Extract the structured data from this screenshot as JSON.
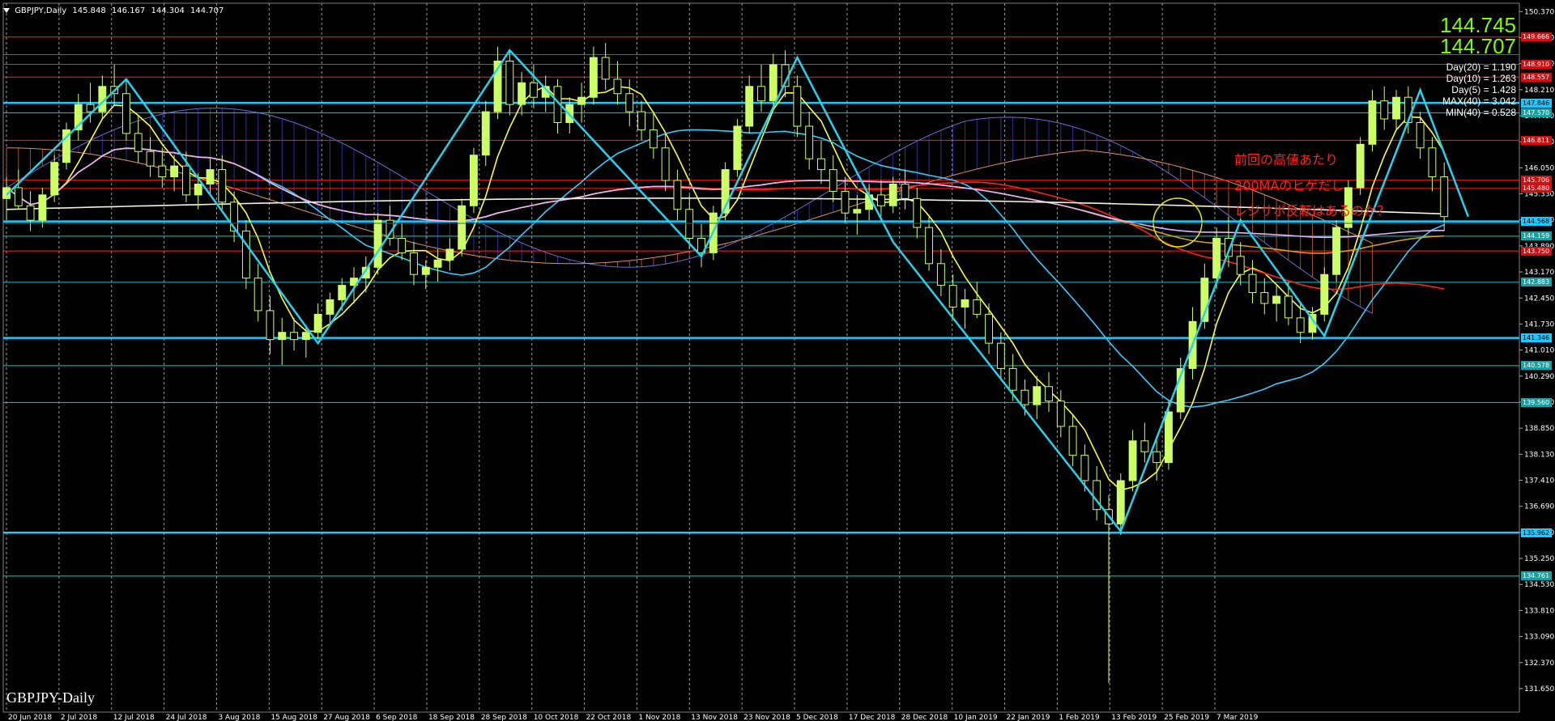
{
  "header": {
    "symbol": "GBPJPY,Daily",
    "open": "145.848",
    "high": "146.167",
    "low": "144.304",
    "close": "144.707"
  },
  "prices": {
    "bid": "144.745",
    "ask": "144.707"
  },
  "stats": [
    "Day(20) = 1.190",
    "Day(10) = 1.263",
    "Day(5) = 1.428",
    "MAX(40) = 3.042",
    "MIN(40) = 0.528"
  ],
  "annotations": [
    "前回の高値あたり",
    "200MAのヒゲだし",
    "レジサポ反転はあるのか？"
  ],
  "chart_label": "GBPJPY-Daily",
  "colors": {
    "background": "#000000",
    "bull_candle": "#ccff66",
    "hline": "#19c8c8",
    "hline_strong": "#1ec8ff",
    "red_line": "#ff2020",
    "annotation": "#ff2020",
    "price_text": "#7cfc00",
    "zigzag": "#21d4f0"
  },
  "chart_data": {
    "type": "candlestick",
    "title": "GBPJPY-Daily",
    "ylim": [
      131.0,
      150.6
    ],
    "y_ticks": [
      "150.370",
      "149.650",
      "148.930",
      "148.210",
      "147.490",
      "146.770",
      "146.050",
      "145.330",
      "144.610",
      "143.890",
      "143.170",
      "142.450",
      "141.730",
      "141.010",
      "140.290",
      "139.570",
      "138.850",
      "138.130",
      "137.410",
      "136.690",
      "135.970",
      "135.250",
      "134.530",
      "133.810",
      "133.090",
      "132.370",
      "131.650"
    ],
    "x_labels": [
      "20 Jun 2018",
      "2 Jul 2018",
      "12 Jul 2018",
      "24 Jul 2018",
      "3 Aug 2018",
      "15 Aug 2018",
      "27 Aug 2018",
      "6 Sep 2018",
      "18 Sep 2018",
      "28 Sep 2018",
      "10 Oct 2018",
      "22 Oct 2018",
      "1 Nov 2018",
      "13 Nov 2018",
      "23 Nov 2018",
      "5 Dec 2018",
      "17 Dec 2018",
      "28 Dec 2018",
      "10 Jan 2019",
      "22 Jan 2019",
      "1 Feb 2019",
      "13 Feb 2019",
      "25 Feb 2019",
      "7 Mar 2019"
    ],
    "horizontal_levels": [
      {
        "price": 149.666,
        "label": "149.666",
        "color": "#ff2020"
      },
      {
        "price": 149.18,
        "label": "",
        "color": "#ff2020"
      },
      {
        "price": 148.91,
        "label": "148.910",
        "color": "#ff2020"
      },
      {
        "price": 148.557,
        "label": "148.557",
        "color": "#ff2020"
      },
      {
        "price": 147.846,
        "label": "147.846",
        "color": "#1ec8ff"
      },
      {
        "price": 147.57,
        "label": "147.570",
        "color": "#19c8c8"
      },
      {
        "price": 146.811,
        "label": "146.811",
        "color": "#ff2020"
      },
      {
        "price": 145.706,
        "label": "145.706",
        "color": "#ff2020"
      },
      {
        "price": 145.48,
        "label": "145.480",
        "color": "#ff2020"
      },
      {
        "price": 144.568,
        "label": "144.568",
        "color": "#1ec8ff"
      },
      {
        "price": 144.159,
        "label": "144.159",
        "color": "#19c8c8"
      },
      {
        "price": 143.75,
        "label": "143.750",
        "color": "#ff2020"
      },
      {
        "price": 142.883,
        "label": "142.883",
        "color": "#19c8c8"
      },
      {
        "price": 141.346,
        "label": "141.346",
        "color": "#1ec8ff"
      },
      {
        "price": 140.578,
        "label": "140.578",
        "color": "#19c8c8"
      },
      {
        "price": 139.56,
        "label": "139.560",
        "color": "#19c8c8"
      },
      {
        "price": 135.962,
        "label": "135.962",
        "color": "#1ec8ff"
      },
      {
        "price": 134.761,
        "label": "134.761",
        "color": "#19c8c8"
      }
    ],
    "zigzag": [
      {
        "x": 0,
        "y": 145.3
      },
      {
        "x": 10,
        "y": 148.5
      },
      {
        "x": 26,
        "y": 141.2
      },
      {
        "x": 42,
        "y": 149.3
      },
      {
        "x": 58,
        "y": 143.6
      },
      {
        "x": 66,
        "y": 149.1
      },
      {
        "x": 74,
        "y": 144.0
      },
      {
        "x": 93,
        "y": 136.0
      },
      {
        "x": 103,
        "y": 144.6
      },
      {
        "x": 110,
        "y": 141.4
      },
      {
        "x": 118,
        "y": 148.2
      },
      {
        "x": 122,
        "y": 144.7
      }
    ],
    "candles": [
      [
        145.2,
        145.8,
        144.6,
        145.5
      ],
      [
        145.5,
        146.0,
        144.9,
        145.0
      ],
      [
        145.0,
        145.4,
        144.3,
        144.6
      ],
      [
        144.6,
        145.5,
        144.4,
        145.3
      ],
      [
        145.3,
        146.4,
        145.1,
        146.2
      ],
      [
        146.2,
        147.3,
        146.0,
        147.1
      ],
      [
        147.1,
        148.1,
        146.8,
        147.8
      ],
      [
        147.8,
        148.4,
        147.3,
        147.6
      ],
      [
        147.6,
        148.6,
        147.4,
        148.3
      ],
      [
        148.3,
        148.9,
        147.8,
        148.1
      ],
      [
        148.1,
        148.5,
        146.8,
        147.0
      ],
      [
        147.0,
        147.5,
        146.2,
        146.5
      ],
      [
        146.5,
        146.9,
        145.8,
        146.1
      ],
      [
        146.1,
        146.6,
        145.5,
        145.8
      ],
      [
        145.8,
        146.4,
        145.4,
        146.1
      ],
      [
        146.1,
        146.5,
        145.1,
        145.3
      ],
      [
        145.3,
        145.9,
        144.9,
        145.6
      ],
      [
        145.6,
        146.3,
        145.3,
        146.0
      ],
      [
        146.0,
        146.4,
        144.9,
        145.1
      ],
      [
        145.1,
        145.4,
        144.0,
        144.3
      ],
      [
        144.3,
        144.6,
        142.7,
        143.0
      ],
      [
        143.0,
        143.4,
        141.8,
        142.1
      ],
      [
        142.1,
        142.5,
        140.9,
        141.3
      ],
      [
        141.3,
        141.9,
        140.6,
        141.5
      ],
      [
        141.5,
        141.9,
        141.0,
        141.3
      ],
      [
        141.3,
        141.7,
        140.8,
        141.5
      ],
      [
        141.5,
        142.3,
        141.3,
        142.0
      ],
      [
        142.0,
        142.6,
        141.7,
        142.4
      ],
      [
        142.4,
        143.0,
        142.1,
        142.8
      ],
      [
        142.8,
        143.3,
        142.3,
        143.0
      ],
      [
        143.0,
        143.6,
        142.6,
        143.3
      ],
      [
        143.3,
        144.8,
        143.1,
        144.6
      ],
      [
        144.6,
        145.0,
        143.9,
        144.1
      ],
      [
        144.1,
        144.5,
        143.5,
        143.7
      ],
      [
        143.7,
        144.0,
        142.8,
        143.1
      ],
      [
        143.1,
        143.5,
        142.7,
        143.3
      ],
      [
        143.3,
        143.8,
        142.9,
        143.5
      ],
      [
        143.5,
        144.1,
        143.2,
        143.8
      ],
      [
        143.8,
        145.2,
        143.6,
        145.0
      ],
      [
        145.0,
        146.6,
        144.8,
        146.4
      ],
      [
        146.4,
        147.9,
        146.1,
        147.6
      ],
      [
        147.6,
        149.4,
        147.4,
        149.0
      ],
      [
        149.0,
        149.3,
        147.5,
        147.8
      ],
      [
        147.8,
        148.7,
        147.5,
        148.4
      ],
      [
        148.4,
        148.9,
        147.7,
        148.0
      ],
      [
        148.0,
        148.6,
        147.6,
        148.3
      ],
      [
        148.3,
        148.5,
        147.0,
        147.3
      ],
      [
        147.3,
        148.0,
        147.0,
        147.8
      ],
      [
        147.8,
        148.4,
        147.3,
        148.0
      ],
      [
        148.0,
        149.4,
        147.8,
        149.1
      ],
      [
        149.1,
        149.5,
        148.2,
        148.5
      ],
      [
        148.5,
        149.0,
        147.8,
        148.1
      ],
      [
        148.1,
        148.5,
        147.2,
        147.6
      ],
      [
        147.6,
        147.9,
        146.8,
        147.1
      ],
      [
        147.1,
        147.6,
        146.3,
        146.6
      ],
      [
        146.6,
        147.0,
        145.4,
        145.7
      ],
      [
        145.7,
        146.0,
        144.6,
        144.9
      ],
      [
        144.9,
        145.3,
        143.8,
        144.1
      ],
      [
        144.1,
        144.5,
        143.3,
        143.7
      ],
      [
        143.7,
        145.0,
        143.5,
        144.8
      ],
      [
        144.8,
        146.2,
        144.6,
        146.0
      ],
      [
        146.0,
        147.4,
        145.8,
        147.2
      ],
      [
        147.2,
        148.6,
        147.0,
        148.3
      ],
      [
        148.3,
        148.9,
        147.6,
        147.9
      ],
      [
        147.9,
        149.2,
        147.7,
        148.9
      ],
      [
        148.9,
        149.3,
        148.0,
        148.3
      ],
      [
        148.3,
        148.6,
        146.9,
        147.2
      ],
      [
        147.2,
        147.6,
        146.0,
        146.3
      ],
      [
        146.3,
        146.8,
        145.6,
        146.0
      ],
      [
        146.0,
        146.4,
        145.1,
        145.4
      ],
      [
        145.4,
        145.8,
        144.5,
        144.8
      ],
      [
        144.8,
        145.3,
        144.2,
        144.9
      ],
      [
        144.9,
        145.6,
        144.6,
        145.3
      ],
      [
        145.3,
        145.7,
        144.7,
        145.0
      ],
      [
        145.0,
        145.8,
        144.8,
        145.6
      ],
      [
        145.6,
        146.0,
        144.9,
        145.2
      ],
      [
        145.2,
        145.5,
        144.1,
        144.4
      ],
      [
        144.4,
        144.7,
        143.2,
        143.4
      ],
      [
        143.4,
        143.8,
        142.5,
        142.8
      ],
      [
        142.8,
        143.1,
        141.9,
        142.2
      ],
      [
        142.2,
        142.7,
        141.6,
        142.4
      ],
      [
        142.4,
        142.9,
        141.9,
        142.0
      ],
      [
        142.0,
        142.3,
        140.9,
        141.2
      ],
      [
        141.2,
        141.5,
        140.2,
        140.5
      ],
      [
        140.5,
        140.9,
        139.6,
        139.9
      ],
      [
        139.9,
        140.2,
        139.2,
        139.5
      ],
      [
        139.5,
        140.3,
        139.1,
        140.0
      ],
      [
        140.0,
        140.4,
        139.3,
        139.6
      ],
      [
        139.6,
        139.9,
        138.6,
        138.9
      ],
      [
        138.9,
        139.2,
        137.8,
        138.1
      ],
      [
        138.1,
        138.4,
        137.1,
        137.4
      ],
      [
        137.4,
        137.8,
        136.3,
        136.6
      ],
      [
        136.6,
        137.0,
        131.8,
        136.2
      ],
      [
        136.2,
        137.6,
        135.9,
        137.4
      ],
      [
        137.4,
        138.8,
        137.1,
        138.5
      ],
      [
        138.5,
        139.0,
        137.9,
        138.2
      ],
      [
        138.2,
        138.6,
        137.4,
        137.9
      ],
      [
        137.9,
        139.6,
        137.7,
        139.3
      ],
      [
        139.3,
        140.8,
        139.1,
        140.5
      ],
      [
        140.5,
        142.2,
        140.2,
        141.8
      ],
      [
        141.8,
        143.4,
        141.6,
        143.0
      ],
      [
        143.0,
        144.4,
        142.7,
        144.1
      ],
      [
        144.1,
        144.7,
        143.3,
        143.6
      ],
      [
        143.6,
        144.0,
        142.8,
        143.1
      ],
      [
        143.1,
        143.5,
        142.3,
        142.6
      ],
      [
        142.6,
        143.0,
        142.0,
        142.3
      ],
      [
        142.3,
        142.8,
        141.8,
        142.5
      ],
      [
        142.5,
        142.9,
        141.7,
        141.9
      ],
      [
        141.9,
        142.3,
        141.2,
        141.5
      ],
      [
        141.5,
        142.2,
        141.3,
        142.0
      ],
      [
        142.0,
        143.3,
        141.8,
        143.1
      ],
      [
        143.1,
        144.6,
        142.9,
        144.4
      ],
      [
        144.4,
        145.7,
        144.2,
        145.5
      ],
      [
        145.5,
        146.9,
        145.3,
        146.7
      ],
      [
        146.7,
        148.2,
        146.5,
        147.9
      ],
      [
        147.9,
        148.3,
        147.1,
        147.4
      ],
      [
        147.4,
        148.2,
        147.1,
        148.0
      ],
      [
        148.0,
        148.3,
        147.0,
        147.3
      ],
      [
        147.3,
        147.6,
        146.3,
        146.6
      ],
      [
        146.6,
        146.9,
        145.4,
        145.8
      ],
      [
        145.8,
        146.2,
        144.3,
        144.7
      ]
    ],
    "bid": 144.745,
    "ask": 144.707
  }
}
